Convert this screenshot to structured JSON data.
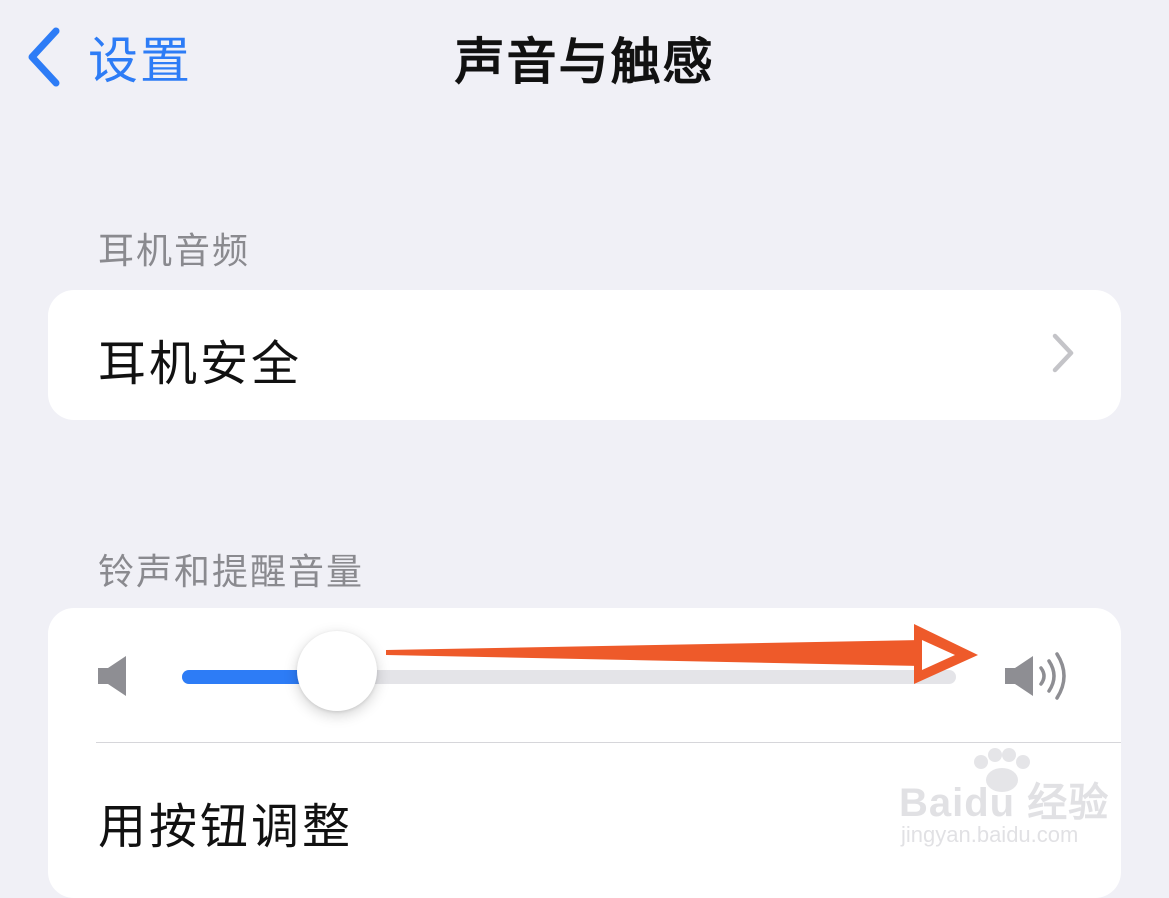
{
  "nav": {
    "back_label": "设置",
    "title": "声音与触感"
  },
  "headphone_section": {
    "header": "耳机音频",
    "row_label": "耳机安全"
  },
  "ringer_section": {
    "header": "铃声和提醒音量",
    "volume_level": 0.2,
    "row_label": "用按钮调整"
  },
  "watermark": {
    "brand": "Baidu 经验",
    "url": "jingyan.baidu.com"
  },
  "colors": {
    "background": "#f0f0f6",
    "accent": "#2d7cf6",
    "annotation_arrow": "#ee5a2a",
    "secondary_text": "#8a8a8f"
  },
  "icons": {
    "back": "chevron-left-icon",
    "disclosure": "chevron-right-icon",
    "volume_low": "speaker-icon",
    "volume_high": "speaker-wave-icon"
  }
}
